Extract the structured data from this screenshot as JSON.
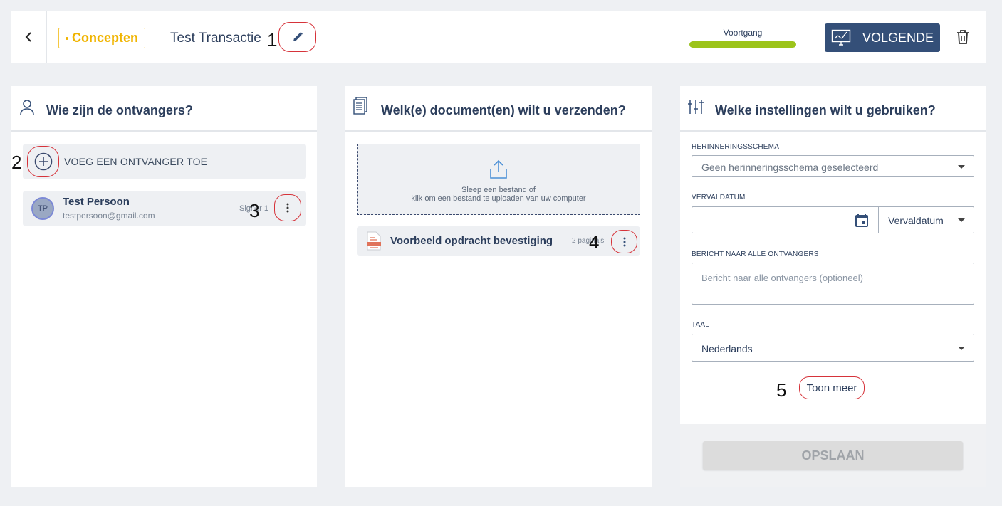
{
  "header": {
    "status_badge": "Concepten",
    "title": "Test Transactie",
    "progress_label": "Voortgang",
    "progress_fraction": 1.0,
    "next_label": "VOLGENDE"
  },
  "markers": [
    "1",
    "2",
    "3",
    "4",
    "5"
  ],
  "recipients_panel": {
    "title": "Wie zijn de ontvangers?",
    "add_label": "VOEG EEN ONTVANGER TOE",
    "recipients": [
      {
        "initials": "TP",
        "name": "Test Persoon",
        "email": "testpersoon@gmail.com",
        "role": "Signer 1"
      }
    ]
  },
  "documents_panel": {
    "title": "Welk(e) document(en) wilt u verzenden?",
    "drop_line1": "Sleep een bestand of",
    "drop_line2": "klik om een bestand te uploaden van uw computer",
    "documents": [
      {
        "name": "Voorbeeld opdracht bevestiging",
        "pages": "2 pagina's"
      }
    ]
  },
  "settings_panel": {
    "title": "Welke instellingen wilt u gebruiken?",
    "reminder_label": "HERINNERINGSSCHEMA",
    "reminder_value": "Geen herinneringsschema geselecteerd",
    "due_label": "VERVALDATUM",
    "due_select": "Vervaldatum",
    "message_label": "BERICHT NAAR ALLE ONTVANGERS",
    "message_placeholder": "Bericht naar alle ontvangers (optioneel)",
    "language_label": "TAAL",
    "language_value": "Nederlands",
    "show_more": "Toon meer",
    "save_label": "OPSLAAN"
  },
  "colors": {
    "primary": "#344f78",
    "progress": "#9cc41a",
    "badge": "#f0b400",
    "annotation": "#d6333a"
  }
}
